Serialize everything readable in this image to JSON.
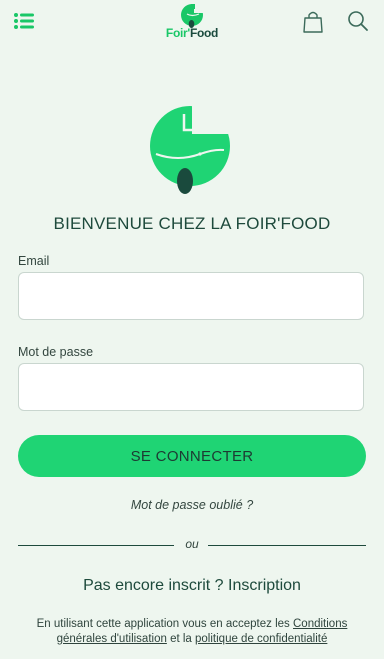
{
  "header": {
    "menu_icon": "hamburger-menu-icon",
    "brand_foir": "Foir'",
    "brand_food": "Food",
    "cart_icon": "shopping-bag-icon",
    "search_icon": "search-icon"
  },
  "welcome": "BIENVENUE CHEZ LA FOIR'FOOD",
  "form": {
    "email_label": "Email",
    "email_value": "",
    "password_label": "Mot de passe",
    "password_value": "",
    "submit_label": "SE CONNECTER",
    "forgot_label": "Mot de passe oublié ?"
  },
  "divider_label": "ou",
  "signup_label": "Pas encore inscrit ? Inscription",
  "legal": {
    "prefix": "En utilisant cette application vous en acceptez les ",
    "terms_link": "Conditions générales d'utilisation",
    "middle": " et la ",
    "privacy_link": "politique de confidentialité"
  },
  "colors": {
    "accent": "#1fd474",
    "brand_dark": "#1a4a3d",
    "background": "#eef6ef"
  }
}
